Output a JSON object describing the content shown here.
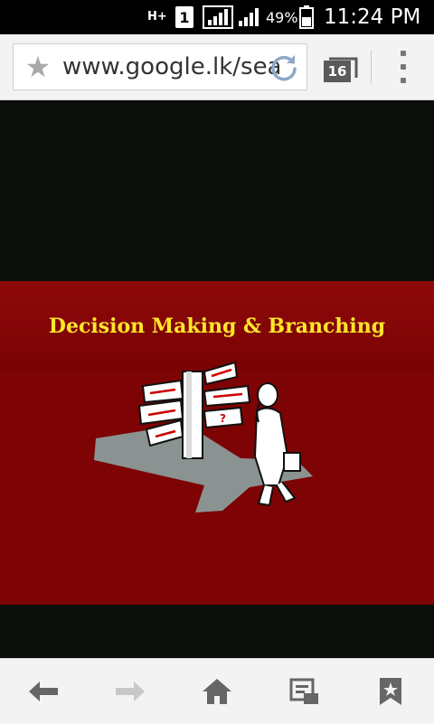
{
  "status_bar": {
    "network_type": "H+",
    "sim_slot": "1",
    "battery_percent": "49%",
    "time": "11:24 PM"
  },
  "browser": {
    "url": "www.google.lk/search",
    "tab_count": "16"
  },
  "slide": {
    "title": "Decision Making & Branching"
  },
  "bottom_nav": {
    "icons": [
      "back-arrow-icon",
      "forward-arrow-icon",
      "home-icon",
      "reader-mode-icon",
      "bookmark-icon"
    ]
  },
  "colors": {
    "slide_background": "#7d0304",
    "title_color": "#ffe629",
    "page_background": "#0a0f0c"
  }
}
